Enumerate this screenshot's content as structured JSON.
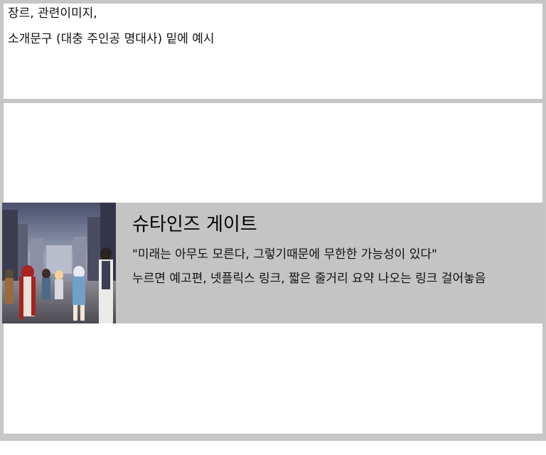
{
  "header": {
    "line1": "장르, 관련이미지,",
    "line2": "소개문구 (대충 주인공 명대사) 밑에 예시"
  },
  "card": {
    "image_alt": "슈타인즈 게이트 key art",
    "title": "슈타인즈 게이트",
    "quote": "\"미래는 아무도 모른다, 그렇기때문에 무한한 가능성이 있다\"",
    "description": "누르면 예고편, 넷플릭스 링크, 짧은 줄거리 요약 나오는 링크 걸어놓음"
  },
  "colors": {
    "frame_border": "#c6c6c6",
    "card_background": "#c4c4c4",
    "page_background": "#ffffff"
  }
}
